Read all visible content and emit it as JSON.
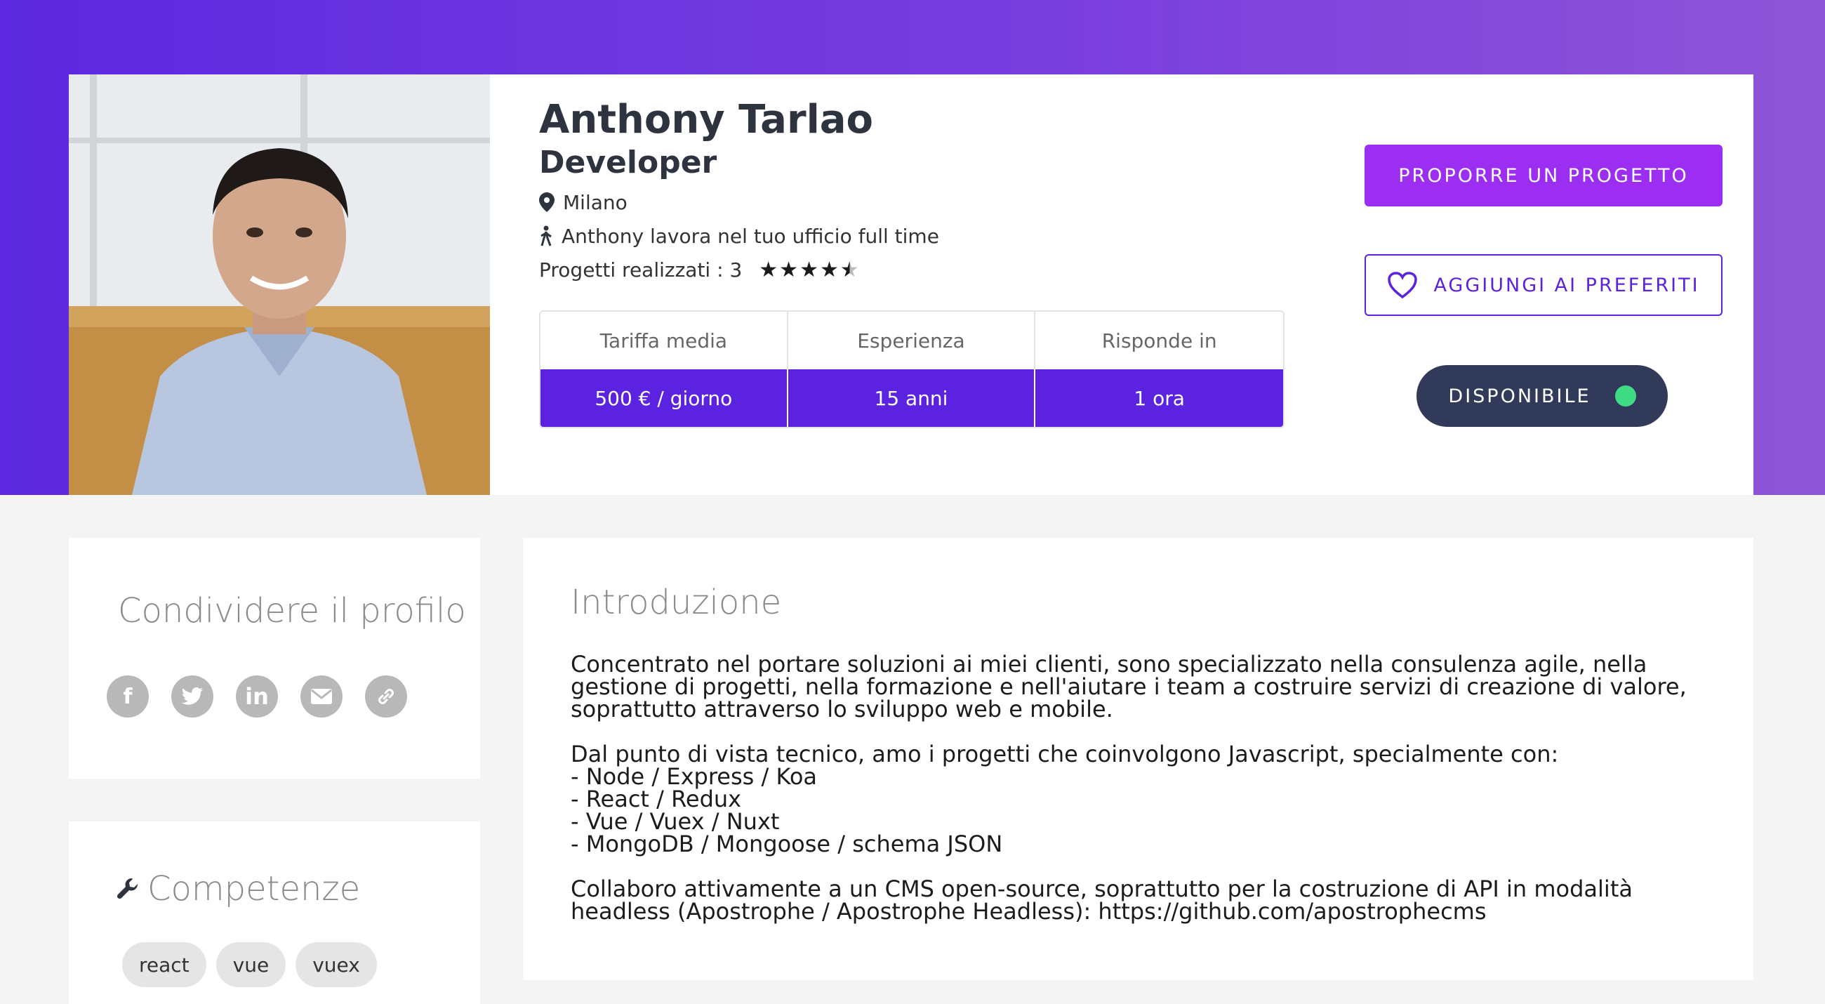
{
  "profile": {
    "name": "Anthony Tarlao",
    "role": "Developer",
    "location": "Milano",
    "work_mode": "Anthony lavora nel tuo ufficio full time",
    "projects_label": "Progetti realizzati : 3",
    "rating": 4.5,
    "rating_max": 5
  },
  "stats": {
    "headers": [
      "Tariffa media",
      "Esperienza",
      "Risponde in"
    ],
    "values": [
      "500 € / giorno",
      "15 anni",
      "1 ora"
    ]
  },
  "actions": {
    "propose": "PROPORRE UN PROGETTO",
    "favorite": "AGGIUNGI AI PREFERITI",
    "availability": "DISPONIBILE"
  },
  "share": {
    "title": "Condividere il profilo",
    "icons": [
      "facebook-icon",
      "twitter-icon",
      "linkedin-icon",
      "email-icon",
      "link-icon"
    ]
  },
  "skills": {
    "title": "Competenze",
    "tags": [
      "react",
      "vue",
      "vuex"
    ]
  },
  "intro": {
    "title": "Introduzione",
    "p1": "Concentrato nel portare soluzioni ai miei clienti, sono specializzato nella consulenza agile, nella gestione di progetti, nella formazione e nell'aiutare i team a costruire servizi di creazione di valore, soprattutto attraverso lo sviluppo web e mobile.",
    "p2": "Dal punto di vista tecnico, amo i progetti che coinvolgono Javascript, specialmente con:\n- Node / Express / Koa\n- React / Redux\n- Vue / Vuex / Nuxt\n- MongoDB / Mongoose / schema JSON",
    "p3": "Collaboro attivamente a un CMS open-source, soprattutto per la costruzione di API in modalità headless (Apostrophe / Apostrophe Headless): https://github.com/apostrophecms"
  },
  "colors": {
    "accent": "#5b22e0",
    "primary_button": "#9b2ef0",
    "available_dot": "#3ddc84",
    "dark_pill": "#323a59"
  }
}
